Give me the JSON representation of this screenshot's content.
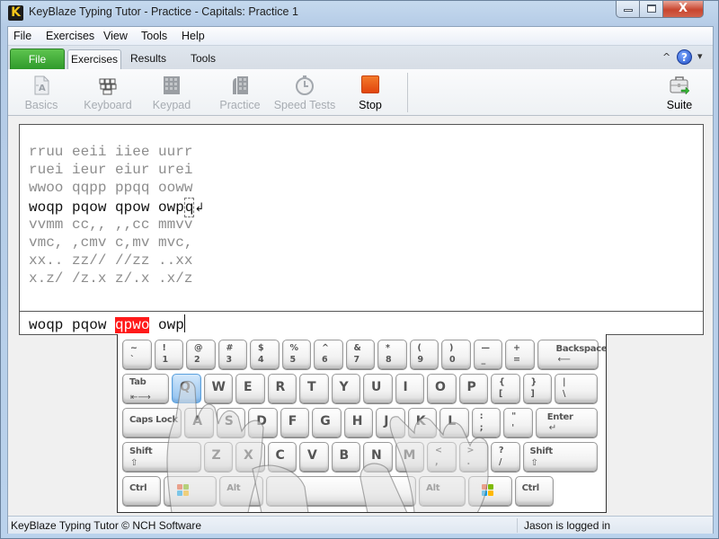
{
  "window": {
    "title": "KeyBlaze Typing Tutor - Practice - Capitals: Practice 1",
    "app_icon_glyph": "K",
    "close_glyph": "X"
  },
  "menubar": {
    "items": [
      "File",
      "Exercises",
      "View",
      "Tools",
      "Help"
    ]
  },
  "ribbon_tabs": {
    "file": "File",
    "tabs": [
      {
        "label": "Exercises",
        "active": true
      },
      {
        "label": "Results",
        "active": false
      },
      {
        "label": "Tools",
        "active": false
      }
    ],
    "minimize_glyph": "^",
    "help_glyph": "?",
    "dropdown_glyph": "▾"
  },
  "ribbon": {
    "buttons": [
      {
        "label": "Basics",
        "icon": "basics-icon",
        "enabled": false
      },
      {
        "label": "Keyboard",
        "icon": "keyboard-icon",
        "enabled": false
      },
      {
        "label": "Keypad",
        "icon": "keypad-icon",
        "enabled": false
      },
      {
        "label": "Practice",
        "icon": "practice-icon",
        "enabled": false
      },
      {
        "label": "Speed Tests",
        "icon": "stopwatch-icon",
        "enabled": false
      },
      {
        "label": "Stop",
        "icon": "stop-icon",
        "enabled": true
      }
    ],
    "suite": {
      "label": "Suite",
      "icon": "suite-briefcase-icon"
    }
  },
  "exercise": {
    "lines": [
      "rruu eeii iiee uurr",
      "ruei ieur eiur urei",
      "wwoo qqpp ppqq ooww",
      "woqp pqow qpow owpq",
      "vvmm cc,, ,,cc mmvv",
      "vmc, ,cmv c,mv mvc,",
      "xx.. zz// //zz ..xx",
      "x.z/ /z.x z/.x .x/z"
    ],
    "current_line_index": 3,
    "current_line_prefix": "woqp pqow qpow owp",
    "current_char": "q",
    "return_glyph": "↲"
  },
  "typed": {
    "before_error": "woqp pqow ",
    "error_word": "qpwo",
    "after_error": " owp"
  },
  "keyboard": {
    "highlighted_key": "Q",
    "rows": [
      [
        [
          "~",
          "`"
        ],
        [
          "!",
          "1"
        ],
        [
          "@",
          "2"
        ],
        [
          "#",
          "3"
        ],
        [
          "$",
          "4"
        ],
        [
          "%",
          "5"
        ],
        [
          "^",
          "6"
        ],
        [
          "&",
          "7"
        ],
        [
          "*",
          "8"
        ],
        [
          "(",
          "9"
        ],
        [
          ")",
          "0"
        ],
        [
          "—",
          "_"
        ],
        [
          "+",
          "="
        ],
        [
          "Backspace"
        ]
      ],
      [
        [
          "Tab"
        ],
        [
          "Q"
        ],
        [
          "W"
        ],
        [
          "E"
        ],
        [
          "R"
        ],
        [
          "T"
        ],
        [
          "Y"
        ],
        [
          "U"
        ],
        [
          "I"
        ],
        [
          "O"
        ],
        [
          "P"
        ],
        [
          "{",
          "["
        ],
        [
          "}",
          "]"
        ],
        [
          "|",
          "\\"
        ]
      ],
      [
        [
          "Caps Lock"
        ],
        [
          "A"
        ],
        [
          "S"
        ],
        [
          "D"
        ],
        [
          "F"
        ],
        [
          "G"
        ],
        [
          "H"
        ],
        [
          "J"
        ],
        [
          "K"
        ],
        [
          "L"
        ],
        [
          ":",
          ";"
        ],
        [
          "\"",
          "'"
        ],
        [
          "Enter"
        ]
      ],
      [
        [
          "Shift"
        ],
        [
          "Z"
        ],
        [
          "X"
        ],
        [
          "C"
        ],
        [
          "V"
        ],
        [
          "B"
        ],
        [
          "N"
        ],
        [
          "M"
        ],
        [
          "<",
          ","
        ],
        [
          ">",
          "."
        ],
        [
          "?",
          "/"
        ],
        [
          "Shift"
        ]
      ],
      [
        [
          "Ctrl"
        ],
        [
          "win"
        ],
        [
          "Alt"
        ],
        [
          "space"
        ],
        [
          "Alt"
        ],
        [
          "win"
        ],
        [
          "Ctrl"
        ]
      ]
    ]
  },
  "statusbar": {
    "left": "KeyBlaze Typing Tutor © NCH Software",
    "right": "Jason is logged in"
  }
}
